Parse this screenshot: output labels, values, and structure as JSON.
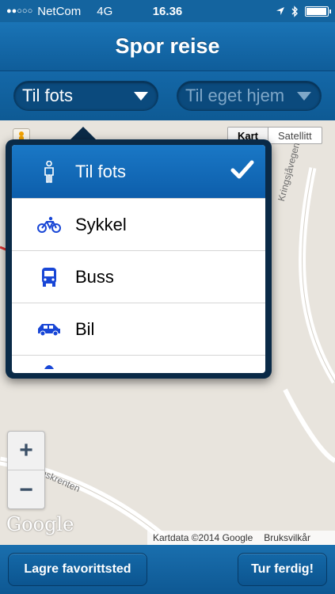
{
  "status_bar": {
    "signal": "●●○○○",
    "carrier": "NetCom",
    "network": "4G",
    "time": "16.36",
    "battery_level": 0.95
  },
  "nav": {
    "title": "Spor reise"
  },
  "selectors": {
    "mode": "Til fots",
    "destination": "Til eget hjem"
  },
  "map": {
    "map_type_active": "Kart",
    "map_type_other": "Satellitt",
    "street_1": "Kringsjåvegen",
    "street_2": "oskrenten",
    "zoom_in": "+",
    "zoom_out": "−",
    "logo": "Google",
    "attribution": "Kartdata ©2014 Google",
    "terms": "Bruksvilkår"
  },
  "popover": {
    "options": [
      {
        "label": "Til fots",
        "icon": "walking-person-icon",
        "selected": true
      },
      {
        "label": "Sykkel",
        "icon": "bicycle-icon",
        "selected": false
      },
      {
        "label": "Buss",
        "icon": "bus-icon",
        "selected": false
      },
      {
        "label": "Bil",
        "icon": "car-icon",
        "selected": false
      }
    ]
  },
  "toolbar": {
    "save_favorite": "Lagre favorittsted",
    "finish_trip": "Tur ferdig!"
  },
  "colors": {
    "bar_blue": "#14649f",
    "selected_blue": "#1a78c6",
    "icon_blue": "#1846d6"
  }
}
